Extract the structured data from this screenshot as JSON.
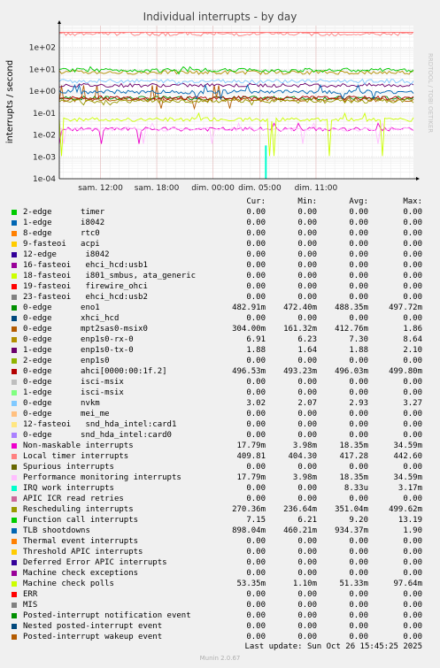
{
  "chart_data": {
    "type": "line",
    "title": "Individual interrupts - by day",
    "ylabel": "interrupts / second",
    "yscale": "log",
    "ylim": [
      0.0001,
      1000
    ],
    "y_ticks": [
      "1e-04",
      "1e-03",
      "1e-02",
      "1e-01",
      "1e+00",
      "1e+01",
      "1e+02"
    ],
    "x_ticks": [
      "sam. 12:00",
      "sam. 18:00",
      "dim. 00:00",
      "dim. 05:00",
      "dim. 11:00"
    ],
    "x_range_hours": [
      -4.4,
      33.4
    ],
    "x_tick_hours": [
      0,
      6,
      12,
      17,
      23
    ],
    "grid": true,
    "upper_limit_line": 500,
    "watermark": "RRDTOOL / TOBI OETIKER",
    "columns": [
      "Cur:",
      "Min:",
      "Avg:",
      "Max:"
    ],
    "series": [
      {
        "name": "2-edge      timer",
        "color": "#00cc00",
        "cur": "0.00",
        "min": "0.00",
        "avg": "0.00",
        "max": "0.00"
      },
      {
        "name": "1-edge      i8042",
        "color": "#0066b3",
        "cur": "0.00",
        "min": "0.00",
        "avg": "0.00",
        "max": "0.00"
      },
      {
        "name": "8-edge      rtc0",
        "color": "#ff8000",
        "cur": "0.00",
        "min": "0.00",
        "avg": "0.00",
        "max": "0.00"
      },
      {
        "name": "9-fasteoi   acpi",
        "color": "#ffcc00",
        "cur": "0.00",
        "min": "0.00",
        "avg": "0.00",
        "max": "0.00"
      },
      {
        "name": "12-edge      i8042",
        "color": "#330099",
        "cur": "0.00",
        "min": "0.00",
        "avg": "0.00",
        "max": "0.00"
      },
      {
        "name": "16-fasteoi   ehci_hcd:usb1",
        "color": "#990099",
        "cur": "0.00",
        "min": "0.00",
        "avg": "0.00",
        "max": "0.00"
      },
      {
        "name": "18-fasteoi   i801_smbus, ata_generic",
        "color": "#ccff00",
        "cur": "0.00",
        "min": "0.00",
        "avg": "0.00",
        "max": "0.00"
      },
      {
        "name": "19-fasteoi   firewire_ohci",
        "color": "#ff0000",
        "cur": "0.00",
        "min": "0.00",
        "avg": "0.00",
        "max": "0.00"
      },
      {
        "name": "23-fasteoi   ehci_hcd:usb2",
        "color": "#808080",
        "cur": "0.00",
        "min": "0.00",
        "avg": "0.00",
        "max": "0.00"
      },
      {
        "name": "0-edge      eno1",
        "color": "#008f00",
        "cur": "482.91m",
        "min": "472.40m",
        "avg": "488.35m",
        "max": "497.72m"
      },
      {
        "name": "0-edge      xhci_hcd",
        "color": "#00487d",
        "cur": "0.00",
        "min": "0.00",
        "avg": "0.00",
        "max": "0.00"
      },
      {
        "name": "0-edge      mpt2sas0-msix0",
        "color": "#b35a00",
        "cur": "304.00m",
        "min": "161.32m",
        "avg": "412.76m",
        "max": "1.86"
      },
      {
        "name": "0-edge      enp1s0-rx-0",
        "color": "#b38f00",
        "cur": "6.91",
        "min": "6.23",
        "avg": "7.30",
        "max": "8.64"
      },
      {
        "name": "1-edge      enp1s0-tx-0",
        "color": "#6b006b",
        "cur": "1.88",
        "min": "1.64",
        "avg": "1.88",
        "max": "2.10"
      },
      {
        "name": "2-edge      enp1s0",
        "color": "#8fb300",
        "cur": "0.00",
        "min": "0.00",
        "avg": "0.00",
        "max": "0.00"
      },
      {
        "name": "0-edge      ahci[0000:00:1f.2]",
        "color": "#b30000",
        "cur": "496.53m",
        "min": "493.23m",
        "avg": "496.03m",
        "max": "499.80m"
      },
      {
        "name": "0-edge      isci-msix",
        "color": "#bebebe",
        "cur": "0.00",
        "min": "0.00",
        "avg": "0.00",
        "max": "0.00"
      },
      {
        "name": "1-edge      isci-msix",
        "color": "#80ff80",
        "cur": "0.00",
        "min": "0.00",
        "avg": "0.00",
        "max": "0.00"
      },
      {
        "name": "0-edge      nvkm",
        "color": "#80c9ff",
        "cur": "3.02",
        "min": "2.07",
        "avg": "2.93",
        "max": "3.27"
      },
      {
        "name": "0-edge      mei_me",
        "color": "#ffc080",
        "cur": "0.00",
        "min": "0.00",
        "avg": "0.00",
        "max": "0.00"
      },
      {
        "name": "12-fasteoi   snd_hda_intel:card1",
        "color": "#ffe680",
        "cur": "0.00",
        "min": "0.00",
        "avg": "0.00",
        "max": "0.00"
      },
      {
        "name": "0-edge      snd_hda_intel:card0",
        "color": "#aa80ff",
        "cur": "0.00",
        "min": "0.00",
        "avg": "0.00",
        "max": "0.00"
      },
      {
        "name": "Non-maskable interrupts",
        "color": "#ee00cc",
        "cur": "17.79m",
        "min": "3.98m",
        "avg": "18.35m",
        "max": "34.59m"
      },
      {
        "name": "Local timer interrupts",
        "color": "#ff8080",
        "cur": "409.81",
        "min": "404.30",
        "avg": "417.28",
        "max": "442.60"
      },
      {
        "name": "Spurious interrupts",
        "color": "#666600",
        "cur": "0.00",
        "min": "0.00",
        "avg": "0.00",
        "max": "0.00"
      },
      {
        "name": "Performance monitoring interrupts",
        "color": "#ffbfff",
        "cur": "17.79m",
        "min": "3.98m",
        "avg": "18.35m",
        "max": "34.59m"
      },
      {
        "name": "IRQ work interrupts",
        "color": "#00ffcc",
        "cur": "0.00",
        "min": "0.00",
        "avg": "8.33u",
        "max": "3.17m"
      },
      {
        "name": "APIC ICR read retries",
        "color": "#cc6699",
        "cur": "0.00",
        "min": "0.00",
        "avg": "0.00",
        "max": "0.00"
      },
      {
        "name": "Rescheduling interrupts",
        "color": "#999900",
        "cur": "270.36m",
        "min": "236.64m",
        "avg": "351.04m",
        "max": "499.62m"
      },
      {
        "name": "Function call interrupts",
        "color": "#00cc00",
        "cur": "7.15",
        "min": "6.21",
        "avg": "9.20",
        "max": "13.19"
      },
      {
        "name": "TLB shootdowns",
        "color": "#0066b3",
        "cur": "898.04m",
        "min": "460.21m",
        "avg": "934.37m",
        "max": "1.90"
      },
      {
        "name": "Thermal event interrupts",
        "color": "#ff8000",
        "cur": "0.00",
        "min": "0.00",
        "avg": "0.00",
        "max": "0.00"
      },
      {
        "name": "Threshold APIC interrupts",
        "color": "#ffcc00",
        "cur": "0.00",
        "min": "0.00",
        "avg": "0.00",
        "max": "0.00"
      },
      {
        "name": "Deferred Error APIC interrupts",
        "color": "#330099",
        "cur": "0.00",
        "min": "0.00",
        "avg": "0.00",
        "max": "0.00"
      },
      {
        "name": "Machine check exceptions",
        "color": "#990099",
        "cur": "0.00",
        "min": "0.00",
        "avg": "0.00",
        "max": "0.00"
      },
      {
        "name": "Machine check polls",
        "color": "#ccff00",
        "cur": "53.35m",
        "min": "1.10m",
        "avg": "51.33m",
        "max": "97.64m"
      },
      {
        "name": "ERR",
        "color": "#ff0000",
        "cur": "0.00",
        "min": "0.00",
        "avg": "0.00",
        "max": "0.00"
      },
      {
        "name": "MIS",
        "color": "#808080",
        "cur": "0.00",
        "min": "0.00",
        "avg": "0.00",
        "max": "0.00"
      },
      {
        "name": "Posted-interrupt notification event",
        "color": "#008f00",
        "cur": "0.00",
        "min": "0.00",
        "avg": "0.00",
        "max": "0.00"
      },
      {
        "name": "Nested posted-interrupt event",
        "color": "#00487d",
        "cur": "0.00",
        "min": "0.00",
        "avg": "0.00",
        "max": "0.00"
      },
      {
        "name": "Posted-interrupt wakeup event",
        "color": "#b35a00",
        "cur": "0.00",
        "min": "0.00",
        "avg": "0.00",
        "max": "0.00"
      }
    ]
  },
  "footer": {
    "last_update": "Last update: Sun Oct 26 15:45:25 2025",
    "munin": "Munin 2.0.67"
  }
}
